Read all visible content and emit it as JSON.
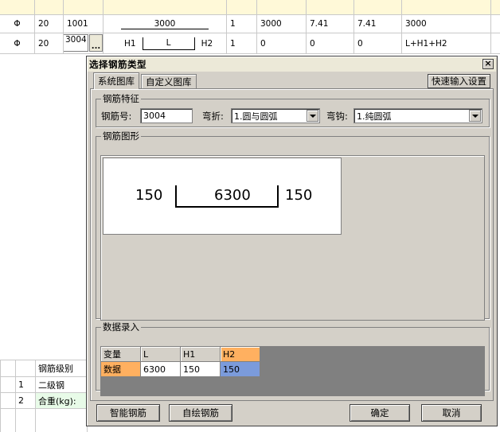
{
  "background_table": {
    "rows": [
      {
        "sym": "",
        "dia": "",
        "code": "",
        "fig": "",
        "root": "",
        "total": "",
        "unit": "",
        "total_wt": "",
        "formula": ""
      },
      {
        "sym": "Φ",
        "dia": "20",
        "code": "1001",
        "fig": "3000",
        "root": "1",
        "total": "3000",
        "unit": "7.41",
        "total_wt": "7.41",
        "formula": "3000"
      },
      {
        "sym": "Φ",
        "dia": "20",
        "code": "3004",
        "fig_h1": "H1",
        "fig_l": "L",
        "fig_h2": "H2",
        "root": "1",
        "total": "0",
        "unit": "0",
        "total_wt": "0",
        "formula": "L+H1+H2",
        "ellipsis": "..."
      }
    ]
  },
  "bottom_table": {
    "header": "钢筋级别",
    "rows": [
      {
        "num": "1",
        "text": "二级钢"
      },
      {
        "num": "2",
        "text": "合重(kg):"
      }
    ]
  },
  "dialog": {
    "title": "选择钢筋类型",
    "close": "×",
    "tabs": [
      "系统图库",
      "自定义图库"
    ],
    "quick_input": "快速输入设置",
    "features": {
      "legend": "钢筋特征",
      "code_label": "钢筋号:",
      "code_value": "3004",
      "bend_label": "弯折:",
      "bend_value": "1.圆与圆弧",
      "hook_label": "弯钩:",
      "hook_value": "1.纯圆弧"
    },
    "shape": {
      "legend": "钢筋图形",
      "left": "150",
      "middle": "6300",
      "right": "150"
    },
    "data_entry": {
      "legend": "数据录入",
      "var_label": "变量",
      "data_label": "数据",
      "columns": [
        "L",
        "H1",
        "H2"
      ],
      "values": [
        "6300",
        "150",
        "150"
      ]
    },
    "buttons": {
      "smart": "智能钢筋",
      "draw": "自绘钢筋",
      "ok": "确定",
      "cancel": "取消"
    }
  }
}
